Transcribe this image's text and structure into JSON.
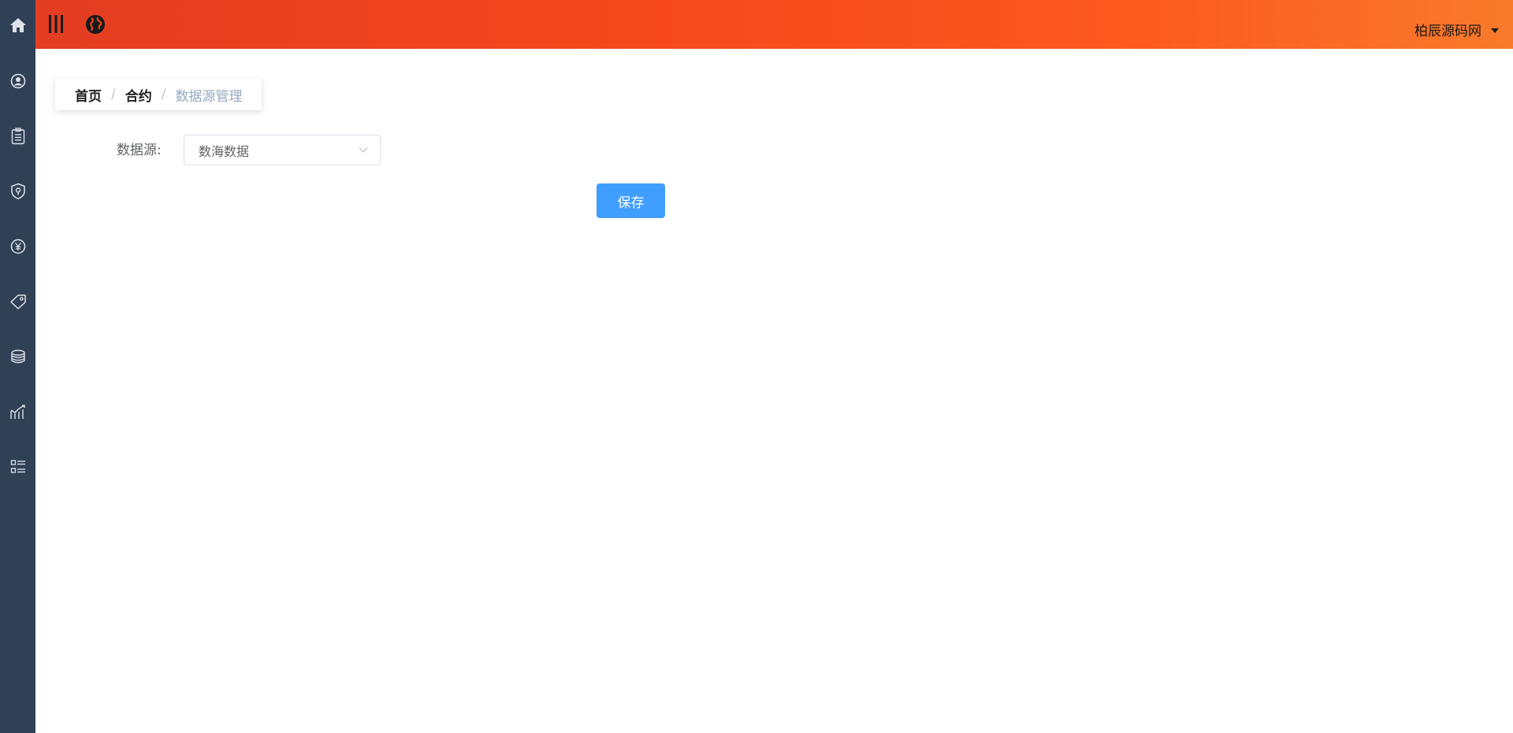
{
  "sidebar": {
    "items": [
      {
        "icon": "home-icon"
      },
      {
        "icon": "user-circle-icon"
      },
      {
        "icon": "clipboard-icon"
      },
      {
        "icon": "shield-location-icon"
      },
      {
        "icon": "yuan-icon"
      },
      {
        "icon": "tag-icon"
      },
      {
        "icon": "coins-stack-icon"
      },
      {
        "icon": "chart-icon"
      },
      {
        "icon": "list-icon"
      }
    ]
  },
  "header": {
    "user_name": "柏辰源码网"
  },
  "breadcrumb": {
    "items": [
      "首页",
      "合约"
    ],
    "current": "数据源管理",
    "separator": "/"
  },
  "form": {
    "label": "数据源:",
    "select_value": "数海数据",
    "save_label": "保存"
  },
  "colors": {
    "sidebar": "#304156",
    "header_start": "#e33d22",
    "header_end": "#f87a2b",
    "primary": "#409eff"
  }
}
